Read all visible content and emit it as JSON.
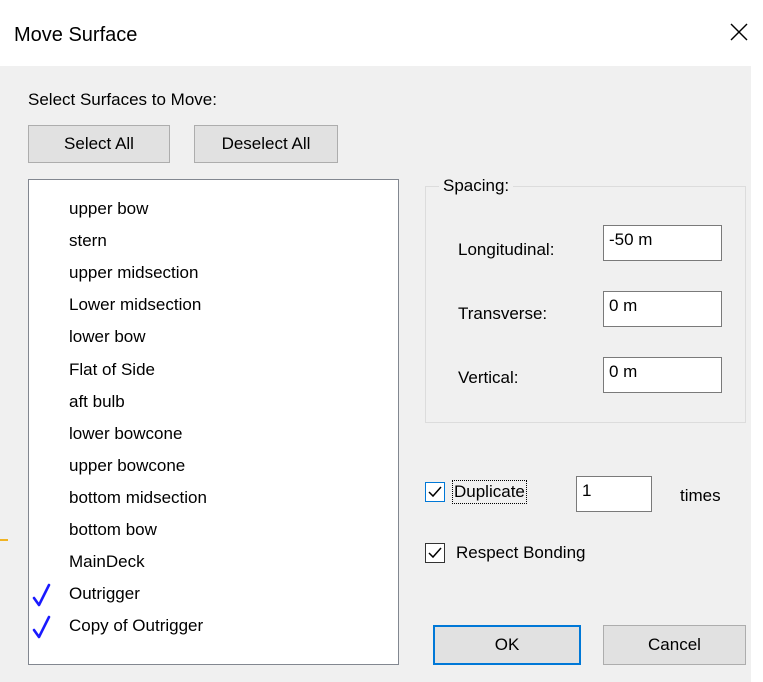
{
  "window": {
    "title": "Move Surface"
  },
  "select_section": {
    "label": "Select Surfaces to Move:",
    "select_all_label": "Select All",
    "deselect_all_label": "Deselect All"
  },
  "surfaces": [
    {
      "name": "upper bow",
      "checked": false
    },
    {
      "name": "stern",
      "checked": false
    },
    {
      "name": "upper midsection",
      "checked": false
    },
    {
      "name": "Lower midsection",
      "checked": false
    },
    {
      "name": "lower bow",
      "checked": false
    },
    {
      "name": "Flat of Side",
      "checked": false
    },
    {
      "name": "aft bulb",
      "checked": false
    },
    {
      "name": "lower bowcone",
      "checked": false
    },
    {
      "name": "upper bowcone",
      "checked": false
    },
    {
      "name": "bottom midsection",
      "checked": false
    },
    {
      "name": "bottom bow",
      "checked": false
    },
    {
      "name": "MainDeck",
      "checked": false
    },
    {
      "name": "Outrigger",
      "checked": true
    },
    {
      "name": "Copy of Outrigger",
      "checked": true
    }
  ],
  "spacing": {
    "legend": "Spacing:",
    "longitudinal_label": "Longitudinal:",
    "longitudinal_value": "-50 m",
    "transverse_label": "Transverse:",
    "transverse_value": "0 m",
    "vertical_label": "Vertical:",
    "vertical_value": "0 m"
  },
  "options": {
    "duplicate_label": "Duplicate",
    "duplicate_checked": true,
    "duplicate_count": "1",
    "times_label": "times",
    "respect_bonding_label": "Respect Bonding",
    "respect_bonding_checked": true
  },
  "footer": {
    "ok_label": "OK",
    "cancel_label": "Cancel"
  },
  "colors": {
    "dialog_bg": "#f0f0f0",
    "accent_blue": "#0078d7",
    "checkmark_blue": "#1a1aff",
    "accent_orange": "#f0b323"
  }
}
